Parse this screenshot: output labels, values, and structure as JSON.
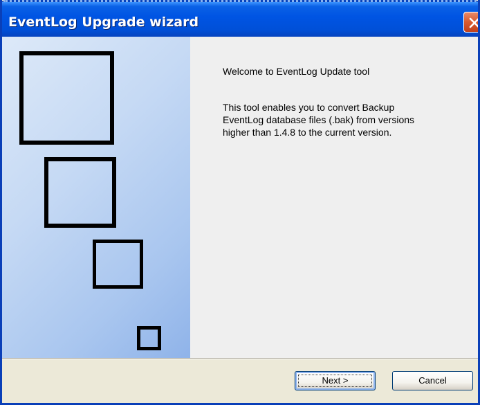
{
  "window": {
    "title": "EventLog Upgrade wizard"
  },
  "titlebar": {
    "close_icon": "close-icon"
  },
  "side_panel": {
    "decoration": "nested-squares"
  },
  "content": {
    "welcome": "Welcome to EventLog Update tool",
    "description_lines": [
      "This tool enables you to convert Backup",
      "EventLog database files (.bak) from versions",
      "higher than 1.4.8 to the current version."
    ]
  },
  "buttons": {
    "next_label": "Next >",
    "cancel_label": "Cancel"
  },
  "colors": {
    "titlebar": "#0054e3",
    "close_button": "#d85a2e",
    "side_panel": "#a9c6ef",
    "content_bg": "#efefef",
    "button_bar": "#ece9d8"
  }
}
